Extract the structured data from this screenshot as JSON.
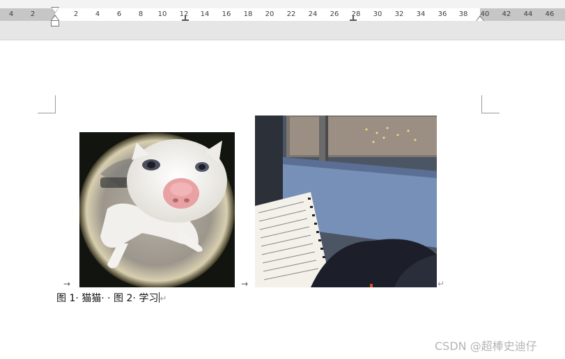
{
  "ruler": {
    "labels": [
      "4",
      "2",
      "2",
      "4",
      "6",
      "8",
      "10",
      "12",
      "14",
      "16",
      "18",
      "20",
      "22",
      "24",
      "26",
      "28",
      "30",
      "32",
      "34",
      "36",
      "38",
      "40",
      "42",
      "44",
      "46"
    ]
  },
  "document": {
    "caption": {
      "fig1_label": "图 1· 猫猫· · 图 2· 学习",
      "paragraph_mark": "↵"
    },
    "tab_arrow": "→",
    "images": [
      {
        "name": "cat-photo",
        "description_icon": "cat-fisheye-image"
      },
      {
        "name": "study-photo",
        "description_icon": "notebook-window-image"
      }
    ]
  },
  "watermark": {
    "text": "CSDN @超棒史迪仔"
  },
  "colors": {
    "ruler_margin": "#c6c6c6",
    "ruler_body": "#ffffff",
    "toolbar_bg": "#e6e6e6",
    "page_bg": "#ffffff"
  }
}
